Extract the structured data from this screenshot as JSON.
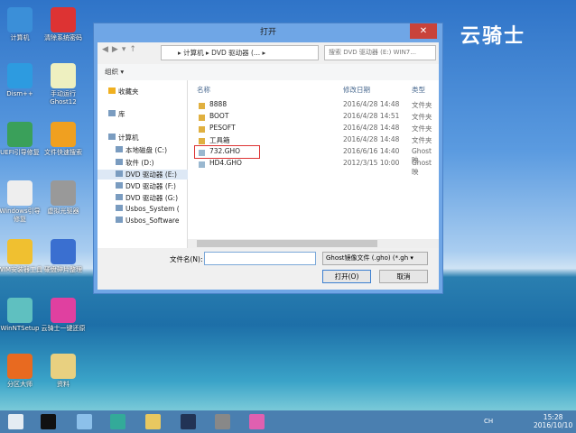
{
  "brand": "云骑士",
  "desktop_icons": [
    {
      "label": "计算机",
      "color": "#3b8fd8"
    },
    {
      "label": "清除系统密码",
      "color": "#d33"
    },
    {
      "label": "Dism++",
      "color": "#2d9be0"
    },
    {
      "label": "手动运行Ghost12",
      "color": "#eef0c0"
    },
    {
      "label": "UEFI引导修复",
      "color": "#3aa05a"
    },
    {
      "label": "文件快速搜索",
      "color": "#f0a020"
    },
    {
      "label": "Windows引导修复",
      "color": "#eee"
    },
    {
      "label": "虚拟光驱器",
      "color": "#999"
    },
    {
      "label": "WIM安装器工具",
      "color": "#f0c030"
    },
    {
      "label": "硬盘碎片整理",
      "color": "#3a6fd0"
    },
    {
      "label": "WinNTSetup",
      "color": "#5fc0c0"
    },
    {
      "label": "云骑士一键还原",
      "color": "#e040a0"
    },
    {
      "label": "分区大师",
      "color": "#e86a20"
    },
    {
      "label": "资料",
      "color": "#e8d080"
    }
  ],
  "dialog": {
    "title": "打开",
    "close": "✕",
    "address": "▸ 计算机 ▸ DVD 驱动器 (... ▸",
    "search_placeholder": "搜索 DVD 驱动器 (E:) WIN7...",
    "organize": "组织 ▾",
    "nav_items": [
      "收藏夹",
      "库",
      "计算机",
      "本地磁盘 (C:)",
      "软件 (D:)",
      "DVD 驱动器 (E:)",
      "DVD 驱动器 (F:)",
      "DVD 驱动器 (G:)",
      "Usbos_System (",
      "Usbos_Software"
    ],
    "columns": {
      "name": "名称",
      "date": "修改日期",
      "type": "类型"
    },
    "files": [
      {
        "name": "8888",
        "date": "2016/4/28 14:48",
        "type": "文件夹",
        "kind": "folder"
      },
      {
        "name": "BOOT",
        "date": "2016/4/28 14:51",
        "type": "文件夹",
        "kind": "folder"
      },
      {
        "name": "PESOFT",
        "date": "2016/4/28 14:48",
        "type": "文件夹",
        "kind": "folder"
      },
      {
        "name": "工具箱",
        "date": "2016/4/28 14:48",
        "type": "文件夹",
        "kind": "folder"
      },
      {
        "name": "732.GHO",
        "date": "2016/6/16 14:40",
        "type": "Ghost 映",
        "kind": "gho",
        "highlighted": true
      },
      {
        "name": "HD4.GHO",
        "date": "2012/3/15 10:00",
        "type": "Ghost 映",
        "kind": "gho"
      }
    ],
    "filename_label": "文件名(N):",
    "filename_value": "",
    "filter": "Ghost镜像文件 (.gho) (*.gh ▾",
    "open": "打开(O)",
    "cancel": "取消"
  },
  "tray": {
    "lang": "CH",
    "time": "15:28",
    "date": "2016/10/10"
  }
}
